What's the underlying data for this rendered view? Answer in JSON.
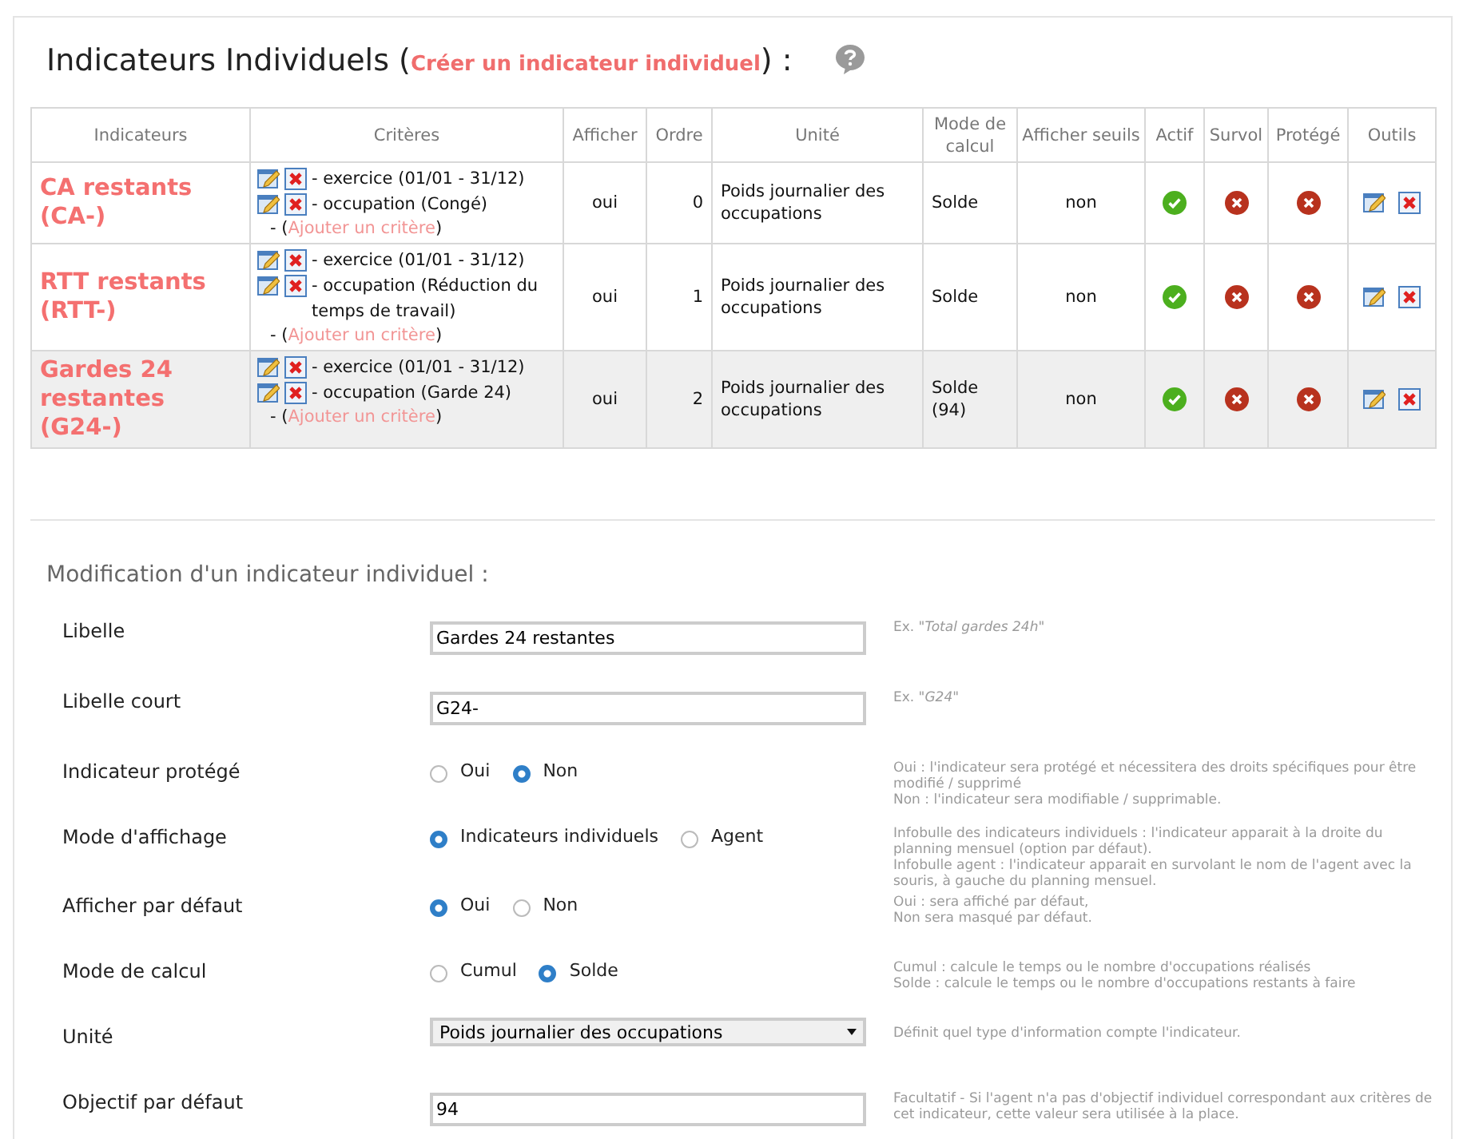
{
  "title": {
    "before": "Indicateurs Individuels (",
    "link": "Créer un indicateur individuel",
    "after": ") :"
  },
  "table": {
    "columns": [
      "Indicateurs",
      "Critères",
      "Afficher",
      "Ordre",
      "Unité",
      "Mode de calcul",
      "Afficher seuils",
      "Actif",
      "Survol",
      "Protégé",
      "Outils"
    ],
    "rows": [
      {
        "selected": false,
        "name": "CA restants (CA-)",
        "criteria": [
          "- exercice (01/01 - 31/12)",
          "- occupation (Congé)"
        ],
        "add": {
          "before": "- (",
          "link": "Ajouter un critère",
          "after": ")"
        },
        "afficher": "oui",
        "ordre": "0",
        "unite": "Poids journalier des occupations",
        "mode": "Solde",
        "seuils": "non",
        "actif": true,
        "survol": false,
        "protege": false
      },
      {
        "selected": false,
        "name": "RTT restants (RTT-)",
        "criteria": [
          "- exercice (01/01 - 31/12)",
          "- occupation (Réduction du temps de travail)"
        ],
        "add": {
          "before": "- (",
          "link": "Ajouter un critère",
          "after": ")"
        },
        "afficher": "oui",
        "ordre": "1",
        "unite": "Poids journalier des occupations",
        "mode": "Solde",
        "seuils": "non",
        "actif": true,
        "survol": false,
        "protege": false
      },
      {
        "selected": true,
        "name": "Gardes 24 restantes (G24-)",
        "criteria": [
          "- exercice (01/01 - 31/12)",
          "- occupation (Garde 24)"
        ],
        "add": {
          "before": "- (",
          "link": "Ajouter un critère",
          "after": ")"
        },
        "afficher": "oui",
        "ordre": "2",
        "unite": "Poids journalier des occupations",
        "mode": "Solde (94)",
        "seuils": "non",
        "actif": true,
        "survol": false,
        "protege": false
      }
    ]
  },
  "form": {
    "heading": "Modification d'un indicateur individuel :",
    "fields": [
      {
        "kind": "text",
        "label": "Libelle",
        "value": "Gardes 24 restantes",
        "hint": [
          "Ex. \"*Total gardes 24h*\""
        ]
      },
      {
        "kind": "text",
        "label": "Libelle court",
        "value": "G24-",
        "hint": [
          "Ex. \"*G24*\""
        ]
      },
      {
        "kind": "radio",
        "label": "Indicateur protégé",
        "options": [
          {
            "label": "Oui",
            "selected": false
          },
          {
            "label": "Non",
            "selected": true
          }
        ],
        "hint": [
          "Oui : l'indicateur sera protégé et nécessitera des droits spécifiques pour être modifié / supprimé",
          "Non : l'indicateur sera modifiable / supprimable."
        ]
      },
      {
        "kind": "radio",
        "label": "Mode d'affichage",
        "options": [
          {
            "label": "Indicateurs individuels",
            "selected": true
          },
          {
            "label": "Agent",
            "selected": false
          }
        ],
        "hint": [
          "Infobulle des indicateurs individuels : l'indicateur apparait à la droite du planning mensuel (option par défaut).",
          "Infobulle agent : l'indicateur apparait en survolant le nom de l'agent avec la souris, à gauche du planning mensuel."
        ]
      },
      {
        "kind": "radio",
        "label": "Afficher par défaut",
        "options": [
          {
            "label": "Oui",
            "selected": true
          },
          {
            "label": "Non",
            "selected": false
          }
        ],
        "hint": [
          "Oui : sera affiché par défaut,",
          "Non sera masqué par défaut."
        ]
      },
      {
        "kind": "radio",
        "label": "Mode de calcul",
        "options": [
          {
            "label": "Cumul",
            "selected": false
          },
          {
            "label": "Solde",
            "selected": true
          }
        ],
        "hint": [
          "Cumul : calcule le temps ou le nombre d'occupations réalisés",
          "Solde : calcule le temps ou le nombre d'occupations restants à faire"
        ]
      },
      {
        "kind": "select",
        "label": "Unité",
        "value": "Poids journalier des occupations",
        "hint": [
          "Définit quel type d'information compte l'indicateur."
        ]
      },
      {
        "kind": "text",
        "label": "Objectif par défaut",
        "value": "94",
        "hint": [
          "Facultatif - Si l'agent n'a pas d'objectif individuel correspondant aux critères de cet indicateur, cette valeur sera utilisée à la place."
        ]
      }
    ]
  }
}
